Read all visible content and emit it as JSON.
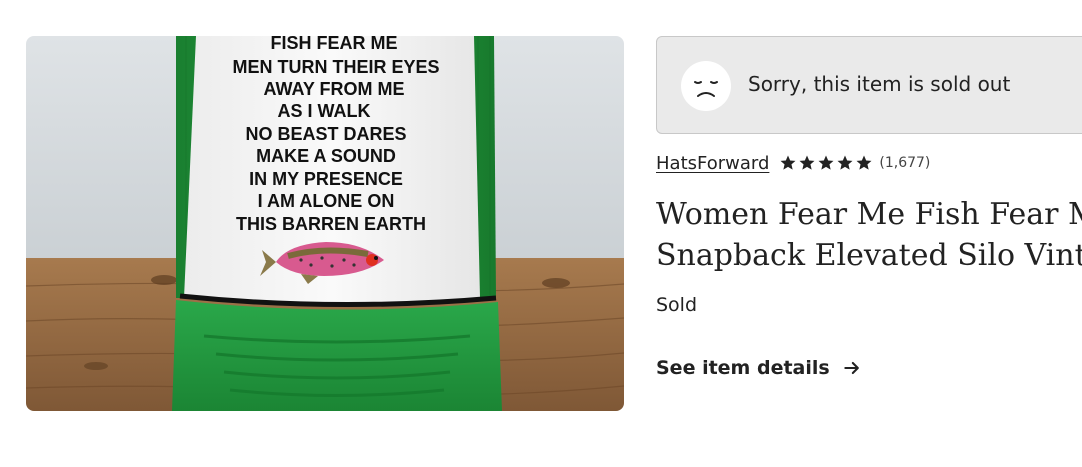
{
  "product_image": {
    "alt_icon": "trucker-hat-photo",
    "hat_text_lines": [
      "FISH FEAR ME",
      "MEN TURN THEIR EYES",
      "AWAY FROM ME",
      "AS I WALK",
      "NO BEAST DARES",
      "MAKE A SOUND",
      "IN MY PRESENCE",
      "I AM ALONE ON",
      "THIS BARREN EARTH"
    ]
  },
  "banner": {
    "icon": "sad-face-icon",
    "message": "Sorry, this item is sold out"
  },
  "shop": {
    "name": "HatsForward",
    "rating": 5,
    "review_count": "(1,677)"
  },
  "listing": {
    "title_line1": "Women Fear Me Fish Fear Me",
    "title_line2": "Snapback Elevated Silo Vintage",
    "status": "Sold"
  },
  "details_link": {
    "label": "See item details",
    "icon": "arrow-right-icon"
  },
  "colors": {
    "banner_bg": "#eaeaea",
    "text": "#222222",
    "hat_green": "#1f9a3a"
  }
}
